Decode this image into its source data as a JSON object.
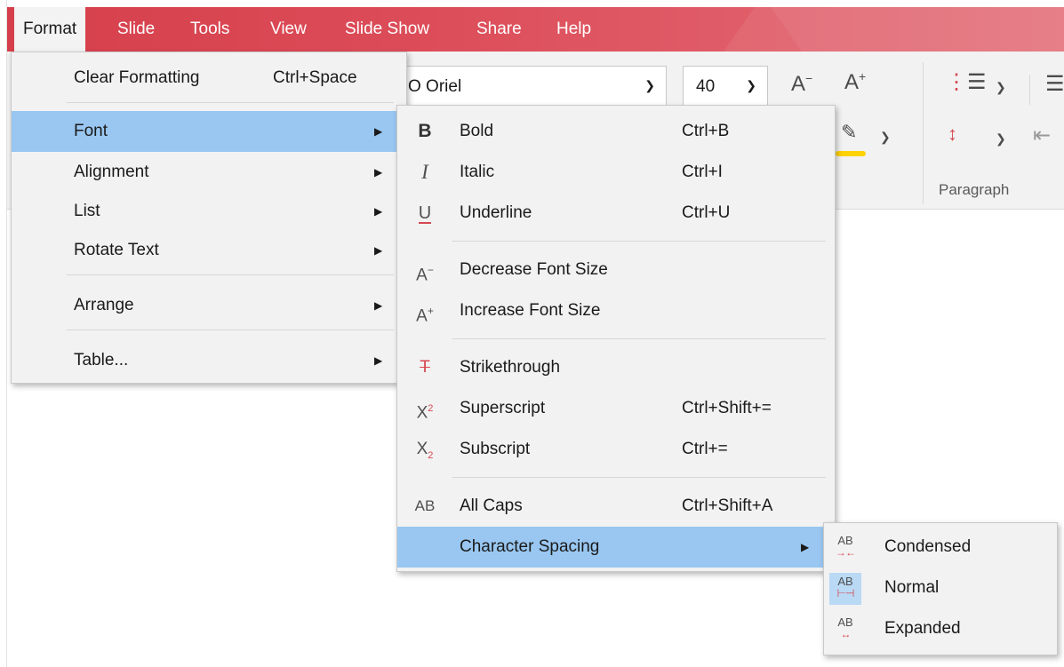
{
  "menubar": {
    "items": [
      "Format",
      "Slide",
      "Tools",
      "View",
      "Slide Show",
      "Share",
      "Help"
    ],
    "active": "Format"
  },
  "ribbon": {
    "font_name": "O Oriel",
    "font_size": "40",
    "paragraph_label": "Paragraph",
    "highlight_color": "#ffd200"
  },
  "format_menu": {
    "items": [
      {
        "label": "Clear Formatting",
        "shortcut": "Ctrl+Space"
      },
      {
        "label": "Font",
        "submenu": true,
        "highlighted": true
      },
      {
        "label": "Alignment",
        "submenu": true
      },
      {
        "label": "List",
        "submenu": true
      },
      {
        "label": "Rotate Text",
        "submenu": true
      },
      {
        "label": "Arrange",
        "submenu": true
      },
      {
        "label": "Table...",
        "submenu": true
      }
    ]
  },
  "font_menu": {
    "items": [
      {
        "icon": "bold-icon",
        "glyph": "B",
        "label": "Bold",
        "shortcut": "Ctrl+B"
      },
      {
        "icon": "italic-icon",
        "glyph": "I",
        "label": "Italic",
        "shortcut": "Ctrl+I"
      },
      {
        "icon": "underline-icon",
        "glyph": "U",
        "label": "Underline",
        "shortcut": "Ctrl+U"
      },
      {
        "icon": "decrease-font-size-icon",
        "glyph": "A",
        "label": "Decrease Font Size"
      },
      {
        "icon": "increase-font-size-icon",
        "glyph": "A",
        "label": "Increase Font Size"
      },
      {
        "icon": "strikethrough-icon",
        "glyph": "T",
        "label": "Strikethrough"
      },
      {
        "icon": "superscript-icon",
        "glyph": "X",
        "label": "Superscript",
        "shortcut": "Ctrl+Shift+="
      },
      {
        "icon": "subscript-icon",
        "glyph": "X",
        "label": "Subscript",
        "shortcut": "Ctrl+="
      },
      {
        "icon": "all-caps-icon",
        "glyph": "AB",
        "label": "All Caps",
        "shortcut": "Ctrl+Shift+A"
      },
      {
        "label": "Character Spacing",
        "submenu": true,
        "highlighted": true
      }
    ]
  },
  "spacing_menu": {
    "items": [
      {
        "icon": "condensed-spacing-icon",
        "label": "Condensed"
      },
      {
        "icon": "normal-spacing-icon",
        "label": "Normal",
        "selected": true
      },
      {
        "icon": "expanded-spacing-icon",
        "label": "Expanded"
      }
    ],
    "icon_text": "AB"
  },
  "colors": {
    "menubar": "#d53f4b",
    "highlight": "#99c7f1",
    "accent_red": "#d64751"
  }
}
